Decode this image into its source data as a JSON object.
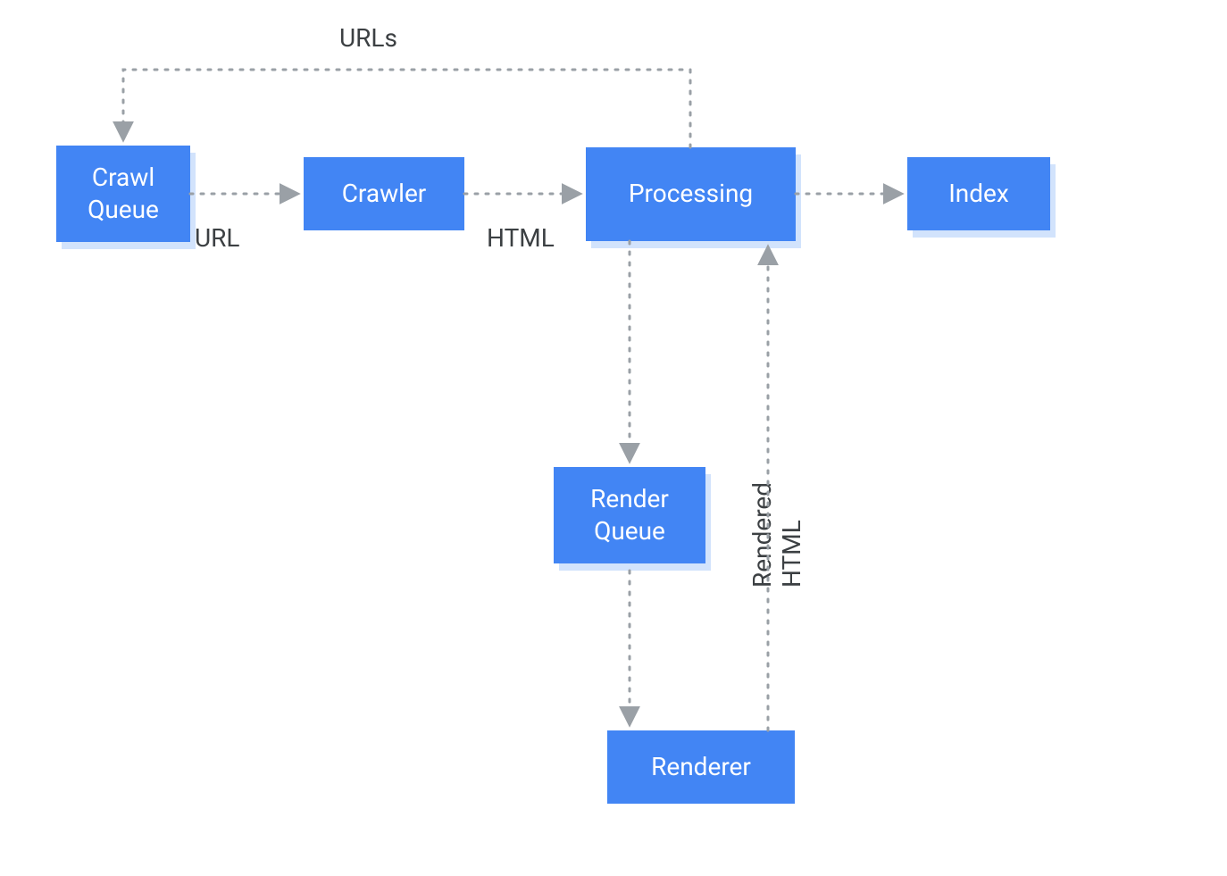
{
  "diagram": {
    "nodes": {
      "crawl_queue": {
        "label": "Crawl\nQueue",
        "has_shadow": true
      },
      "crawler": {
        "label": "Crawler",
        "has_shadow": false
      },
      "processing": {
        "label": "Processing",
        "has_shadow": true
      },
      "index": {
        "label": "Index",
        "has_shadow": true
      },
      "render_queue": {
        "label": "Render\nQueue",
        "has_shadow": true
      },
      "renderer": {
        "label": "Renderer",
        "has_shadow": false
      }
    },
    "edges": {
      "urls_label": "URLs",
      "url_label": "URL",
      "html_label": "HTML",
      "rendered_html_label": "Rendered HTML"
    },
    "colors": {
      "node_bg": "#4285f4",
      "node_shadow": "#d2e3fc",
      "line": "#9aa0a6",
      "text_dark": "#3c4043",
      "text_light": "#ffffff"
    }
  }
}
